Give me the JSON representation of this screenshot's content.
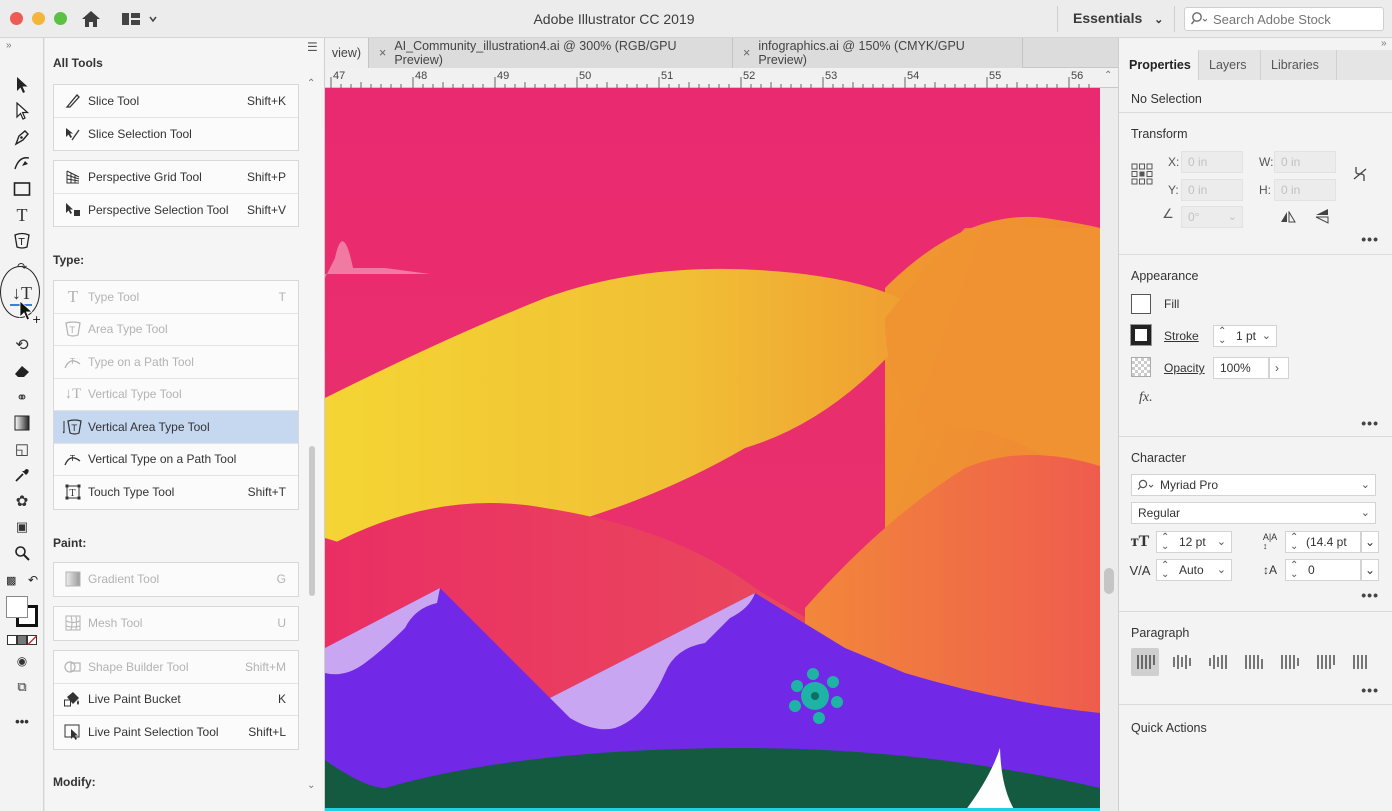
{
  "titlebar": {
    "app_title": "Adobe Illustrator CC 2019",
    "workspace_label": "Essentials",
    "search_placeholder": "Search Adobe Stock"
  },
  "flyout": {
    "title": "All Tools",
    "sections": {
      "type_label": "Type:",
      "paint_label": "Paint:",
      "modify_label": "Modify:"
    },
    "slice_group": [
      {
        "label": "Slice Tool",
        "shortcut": "Shift+K"
      },
      {
        "label": "Slice Selection Tool",
        "shortcut": ""
      }
    ],
    "perspective_group": [
      {
        "label": "Perspective Grid Tool",
        "shortcut": "Shift+P"
      },
      {
        "label": "Perspective Selection Tool",
        "shortcut": "Shift+V"
      }
    ],
    "type_group": [
      {
        "label": "Type Tool",
        "shortcut": "T"
      },
      {
        "label": "Area Type Tool",
        "shortcut": ""
      },
      {
        "label": "Type on a Path Tool",
        "shortcut": ""
      },
      {
        "label": "Vertical Type Tool",
        "shortcut": ""
      },
      {
        "label": "Vertical Area Type Tool",
        "shortcut": ""
      },
      {
        "label": "Vertical Type on a Path Tool",
        "shortcut": ""
      },
      {
        "label": "Touch Type Tool",
        "shortcut": "Shift+T"
      }
    ],
    "paint_group1": [
      {
        "label": "Gradient Tool",
        "shortcut": "G"
      }
    ],
    "paint_group2": [
      {
        "label": "Mesh Tool",
        "shortcut": "U"
      }
    ],
    "paint_group3": [
      {
        "label": "Shape Builder Tool",
        "shortcut": "Shift+M"
      },
      {
        "label": "Live Paint Bucket",
        "shortcut": "K"
      },
      {
        "label": "Live Paint Selection Tool",
        "shortcut": "Shift+L"
      }
    ]
  },
  "document": {
    "tabs": [
      {
        "label": "view)"
      },
      {
        "label": "AI_Community_illustration4.ai @ 300% (RGB/GPU Preview)"
      },
      {
        "label": "infographics.ai @ 150% (CMYK/GPU Preview)"
      }
    ],
    "ruler_numbers": [
      "47",
      "48",
      "49",
      "50",
      "51",
      "52",
      "53",
      "54",
      "55",
      "56"
    ]
  },
  "properties": {
    "tabs": [
      "Properties",
      "Layers",
      "Libraries"
    ],
    "selection_status": "No Selection",
    "transform": {
      "heading": "Transform",
      "x_label": "X:",
      "x_value": "0 in",
      "y_label": "Y:",
      "y_value": "0 in",
      "w_label": "W:",
      "w_value": "0 in",
      "h_label": "H:",
      "h_value": "0 in",
      "angle_value": "0°"
    },
    "appearance": {
      "heading": "Appearance",
      "fill_label": "Fill",
      "stroke_label": "Stroke",
      "stroke_value": "1 pt",
      "opacity_label": "Opacity",
      "opacity_value": "100%",
      "fx_label": "fx."
    },
    "character": {
      "heading": "Character",
      "font_family": "Myriad Pro",
      "font_style": "Regular",
      "font_size": "12 pt",
      "leading": "(14.4 pt",
      "kerning": "Auto",
      "tracking": "0"
    },
    "paragraph": {
      "heading": "Paragraph"
    },
    "quick_actions": {
      "heading": "Quick Actions"
    }
  },
  "colors": {
    "sky": "#e8296e",
    "yellow": "#f2c832",
    "orange": "#f08a2e",
    "purple": "#7029e6",
    "lavender": "#c9a6f0",
    "green": "#145a40",
    "teal": "#1fb3a5",
    "selected_row": "#c5d8f0"
  }
}
